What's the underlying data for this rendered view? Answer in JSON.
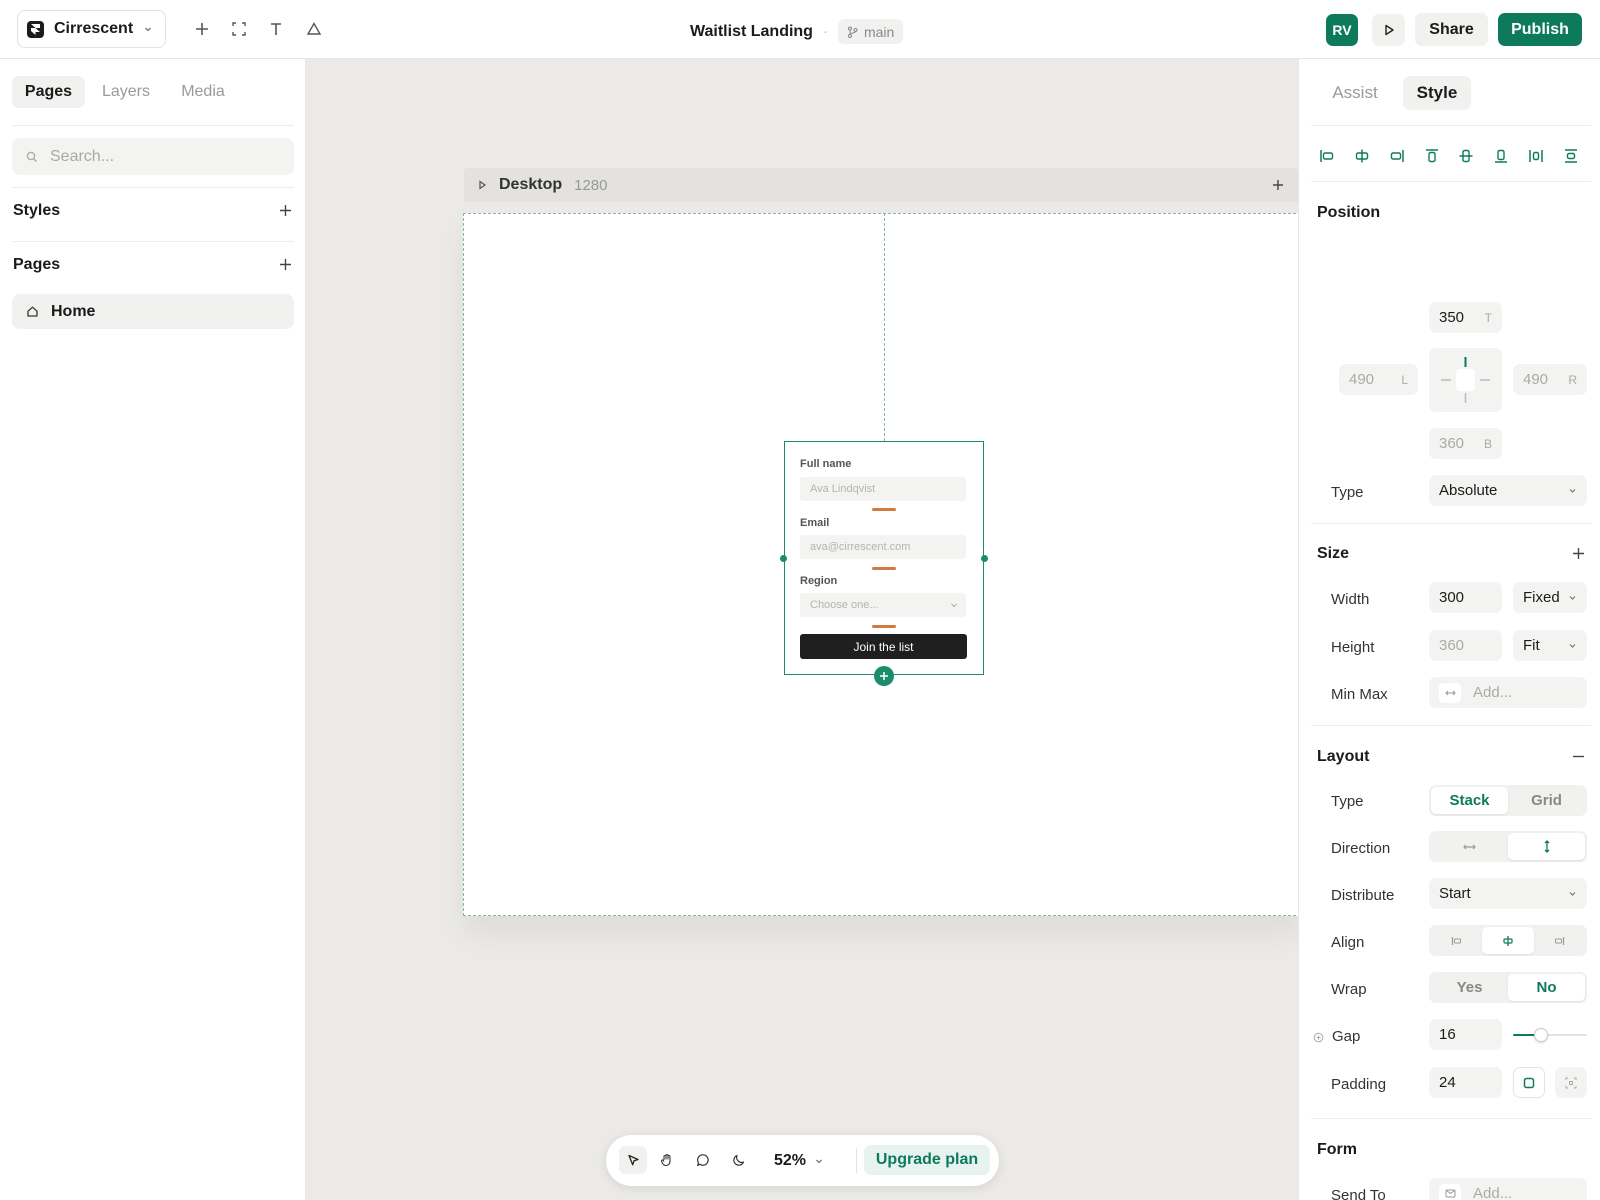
{
  "topbar": {
    "project_name": "Cirrescent",
    "document_title": "Waitlist Landing",
    "title_separator": "·",
    "branch": "main",
    "avatar_initials": "RV",
    "share_label": "Share",
    "publish_label": "Publish"
  },
  "left": {
    "tabs": [
      {
        "label": "Pages"
      },
      {
        "label": "Layers"
      },
      {
        "label": "Media"
      }
    ],
    "search_placeholder": "Search...",
    "styles_title": "Styles",
    "pages_title": "Pages",
    "pages": [
      {
        "label": "Home"
      }
    ]
  },
  "canvas": {
    "frame_name": "Desktop",
    "frame_width": "1280",
    "form": {
      "fields": [
        {
          "label": "Full name",
          "placeholder": "Ava Lindqvist"
        },
        {
          "label": "Email",
          "placeholder": "ava@cirrescent.com"
        },
        {
          "label": "Region",
          "placeholder": "Choose one..."
        }
      ],
      "button_label": "Join the list"
    }
  },
  "bottombar": {
    "zoom": "52%",
    "upgrade_label": "Upgrade plan"
  },
  "right": {
    "tabs": [
      {
        "label": "Assist"
      },
      {
        "label": "Style"
      }
    ],
    "position": {
      "title": "Position",
      "top": "350",
      "top_suffix": "T",
      "left": "490",
      "left_suffix": "L",
      "right": "490",
      "right_suffix": "R",
      "bottom": "360",
      "bottom_suffix": "B",
      "type_label": "Type",
      "type_value": "Absolute"
    },
    "size": {
      "title": "Size",
      "width_label": "Width",
      "width_value": "300",
      "width_mode": "Fixed",
      "height_label": "Height",
      "height_value": "360",
      "height_mode": "Fit",
      "minmax_label": "Min Max",
      "minmax_placeholder": "Add..."
    },
    "layout": {
      "title": "Layout",
      "type_label": "Type",
      "type_options": [
        "Stack",
        "Grid"
      ],
      "type_selected": "Stack",
      "direction_label": "Direction",
      "direction_selected": "vertical",
      "distribute_label": "Distribute",
      "distribute_value": "Start",
      "align_label": "Align",
      "align_selected": "center",
      "wrap_label": "Wrap",
      "wrap_options": [
        "Yes",
        "No"
      ],
      "wrap_selected": "No",
      "gap_label": "Gap",
      "gap_value": "16",
      "gap_slider_fraction": 0.38,
      "padding_label": "Padding",
      "padding_value": "24"
    },
    "form": {
      "title": "Form",
      "send_to_label": "Send To",
      "send_to_placeholder": "Add..."
    }
  },
  "colors": {
    "accent": "#0e7a5c",
    "gap_marker": "#d27a3f",
    "canvas_bg": "#ebeae7"
  }
}
